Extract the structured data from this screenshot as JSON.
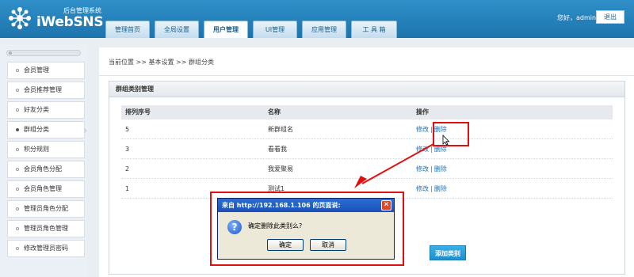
{
  "header": {
    "logo_subtitle": "后台管理系统",
    "logo_name": "iWebSNS",
    "greeting": "您好，admin",
    "logout_label": "退出"
  },
  "nav": {
    "tabs": [
      {
        "label": "管理首页",
        "active": false
      },
      {
        "label": "全局设置",
        "active": false
      },
      {
        "label": "用户管理",
        "active": true
      },
      {
        "label": "UI管理",
        "active": false
      },
      {
        "label": "应用管理",
        "active": false
      },
      {
        "label": "工 具 箱",
        "active": false
      }
    ]
  },
  "sidebar": {
    "items": [
      {
        "label": "会员管理",
        "active": false
      },
      {
        "label": "会员推荐管理",
        "active": false
      },
      {
        "label": "好友分类",
        "active": false
      },
      {
        "label": "群组分类",
        "active": true
      },
      {
        "label": "积分规则",
        "active": false
      },
      {
        "label": "会员角色分配",
        "active": false
      },
      {
        "label": "会员角色管理",
        "active": false
      },
      {
        "label": "管理员角色分配",
        "active": false
      },
      {
        "label": "管理员角色管理",
        "active": false
      },
      {
        "label": "修改管理员密码",
        "active": false
      }
    ]
  },
  "breadcrumb": "当前位置 >> 基本设置 >> 群组分类",
  "panel": {
    "title": "群组类别管理",
    "columns": [
      "排列序号",
      "名称",
      "操作"
    ],
    "rows": [
      {
        "order": "5",
        "name": "新群组名",
        "edit": "修改",
        "delete": "删除"
      },
      {
        "order": "3",
        "name": "看看我",
        "edit": "修改",
        "delete": "删除"
      },
      {
        "order": "2",
        "name": "我爱聚易",
        "edit": "修改",
        "delete": "删除"
      },
      {
        "order": "1",
        "name": "测试1",
        "edit": "修改",
        "delete": "删除"
      }
    ],
    "add_label": "添加类别"
  },
  "dialog": {
    "title": "来自 http://192.168.1.106 的页面说:",
    "message": "确定删除此类别么?",
    "ok_label": "确定",
    "cancel_label": "取消"
  },
  "colors": {
    "header_blue": "#1d74ad",
    "annotation_red": "#e01010",
    "link_blue": "#1b6db3"
  }
}
